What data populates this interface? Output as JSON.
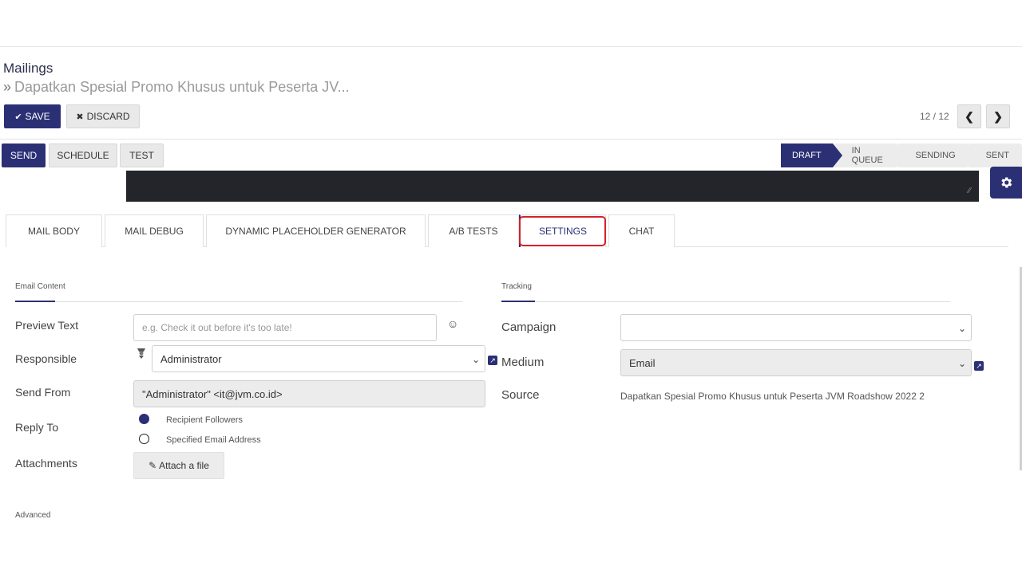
{
  "breadcrumb": {
    "root": "Mailings",
    "separator": "»",
    "current": "Dapatkan Spesial Promo Khusus untuk Peserta JV..."
  },
  "toolbar": {
    "save_label": "SAVE",
    "save_icon": "✔",
    "discard_label": "DISCARD",
    "discard_icon": "✖",
    "pager_text": "12 / 12",
    "prev_icon": "❮",
    "next_icon": "❯"
  },
  "statusbar": {
    "send_label": "SEND",
    "schedule_label": "SCHEDULE",
    "test_label": "TEST",
    "stages": [
      "DRAFT",
      "IN QUEUE",
      "SENDING",
      "SENT"
    ],
    "active_stage": "DRAFT"
  },
  "tabs": [
    {
      "label": "MAIL BODY"
    },
    {
      "label": "MAIL DEBUG"
    },
    {
      "label": "DYNAMIC PLACEHOLDER GENERATOR"
    },
    {
      "label": "A/B TESTS"
    },
    {
      "label": "SETTINGS"
    },
    {
      "label": "CHAT"
    }
  ],
  "active_tab": "SETTINGS",
  "email_content": {
    "title": "Email Content",
    "preview_text_label": "Preview Text",
    "preview_text_placeholder": "e.g. Check it out before it's too late!",
    "emoji_icon": "☺",
    "responsible_label": "Responsible",
    "responsible_value": "Administrator",
    "send_from_label": "Send From",
    "send_from_value": "\"Administrator\" <it@jvm.co.id>",
    "reply_to_label": "Reply To",
    "reply_options": [
      "Recipient Followers",
      "Specified Email Address"
    ],
    "reply_selected": "Recipient Followers",
    "attachments_label": "Attachments",
    "attach_label": "Attach a file",
    "attach_icon": "✎"
  },
  "tracking": {
    "title": "Tracking",
    "campaign_label": "Campaign",
    "campaign_value": "",
    "medium_label": "Medium",
    "medium_value": "Email",
    "source_label": "Source",
    "source_value": "Dapatkan Spesial Promo Khusus untuk Peserta JVM Roadshow 2022 2"
  },
  "advanced": {
    "title": "Advanced"
  },
  "colors": {
    "primary": "#2b3075",
    "highlight": "#d6202a"
  }
}
